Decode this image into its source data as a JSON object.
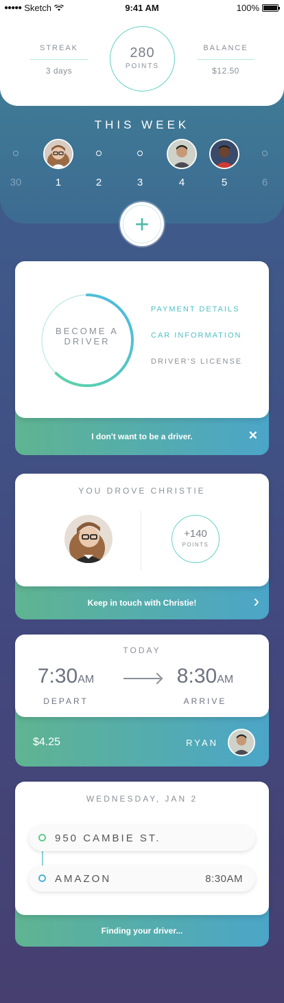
{
  "status": {
    "carrier": "Sketch",
    "time": "9:41 AM",
    "battery": "100%"
  },
  "summary": {
    "streak": {
      "label": "STREAK",
      "value": "3 days"
    },
    "points": {
      "value": "280",
      "unit": "POINTS"
    },
    "balance": {
      "label": "BALANCE",
      "value": "$12.50"
    }
  },
  "week": {
    "title": "THIS WEEK",
    "days": [
      {
        "num": "30",
        "state": "past"
      },
      {
        "num": "1",
        "state": "avatar",
        "person": "woman with glasses"
      },
      {
        "num": "2",
        "state": "empty"
      },
      {
        "num": "3",
        "state": "empty"
      },
      {
        "num": "4",
        "state": "avatar",
        "person": "man"
      },
      {
        "num": "5",
        "state": "avatar",
        "person": "man in red"
      },
      {
        "num": "6",
        "state": "future"
      }
    ]
  },
  "add_button": {
    "icon": "plus-icon",
    "label": "+"
  },
  "driver_card": {
    "ring_text_line1": "BECOME A",
    "ring_text_line2": "DRIVER",
    "ring_progress": 0.62,
    "links": [
      {
        "label": "PAYMENT DETAILS",
        "state": "active"
      },
      {
        "label": "CAR INFORMATION",
        "state": "active"
      },
      {
        "label": "DRIVER'S LICENSE",
        "state": "muted"
      }
    ],
    "footer": "I don't want to be a driver.",
    "footer_icon": "close-icon",
    "footer_icon_glyph": "✕"
  },
  "drove_card": {
    "title": "YOU DROVE CHRISTIE",
    "bonus_value": "+140",
    "bonus_unit": "POINTS",
    "footer": "Keep in touch with Christie!",
    "footer_icon": "chevron-right-icon",
    "footer_icon_glyph": "›"
  },
  "today_card": {
    "title": "TODAY",
    "depart_time": "7:30",
    "depart_suffix": "AM",
    "depart_label": "DEPART",
    "arrive_time": "8:30",
    "arrive_suffix": "AM",
    "arrive_label": "ARRIVE",
    "price": "$4.25",
    "driver_name": "RYAN"
  },
  "trip_card": {
    "date": "WEDNESDAY, JAN 2",
    "origin": "950 CAMBIE ST.",
    "destination": "AMAZON",
    "destination_time": "8:30AM",
    "footer": "Finding your driver..."
  },
  "colors": {
    "accent_teal": "#4ec0c5",
    "accent_green": "#5fb491",
    "accent_blue": "#4ba5c8"
  }
}
